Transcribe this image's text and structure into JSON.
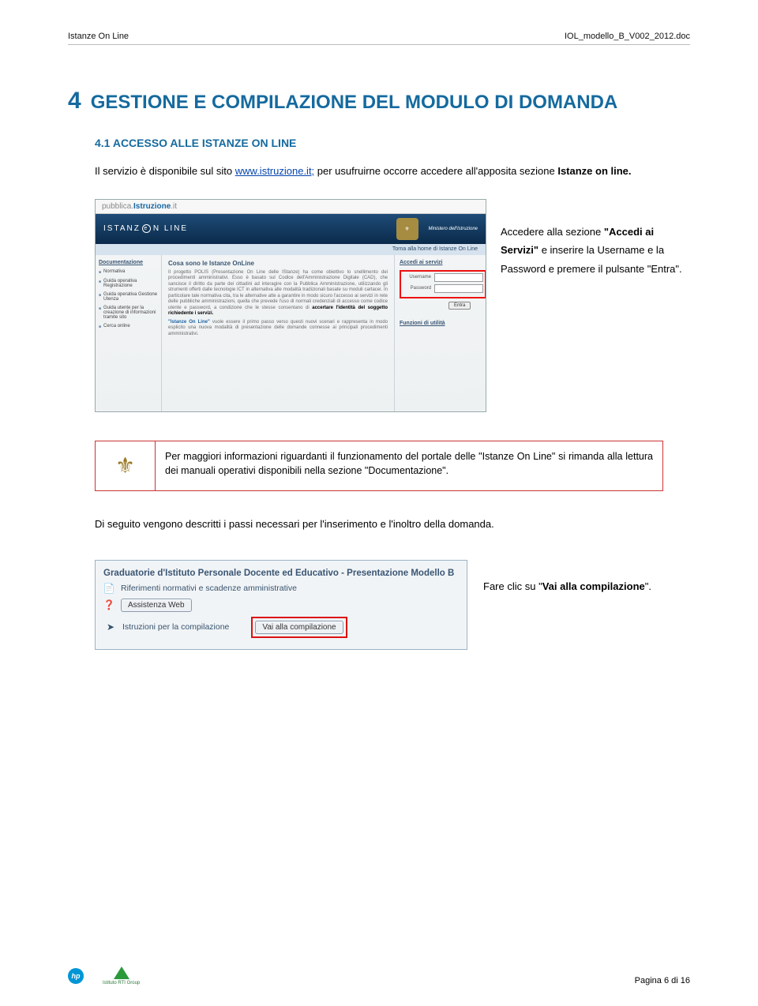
{
  "header": {
    "left": "Istanze On Line",
    "right": "IOL_modello_B_V002_2012.doc"
  },
  "section4": {
    "number": "4",
    "title": "GESTIONE E COMPILAZIONE DEL MODULO DI DOMANDA",
    "subsection_label": "4.1 ACCESSO ALLE ISTANZE ON LINE",
    "para1_a": "Il servizio è disponibile sul sito ",
    "para1_link": "www.istruzione.it;",
    "para1_b": " per usufruirne occorre accedere all'apposita sezione ",
    "para1_bold": "Istanze on line."
  },
  "screenshot": {
    "site_prefix": "pubblica.",
    "site_accent": "Istruzione",
    "site_suffix": ".it",
    "banner_brand_a": "ISTANZ",
    "banner_brand_b": "N LINE",
    "crest_caption": "Ministero dell'Istruzione",
    "subbar": "Torna alla home di Istanze On Line",
    "side_heading": "Documentazione",
    "side_items": [
      "Normativa",
      "Guida operativa Registrazione",
      "Guida operativa Gestione Utenza",
      "Guida utente per la creazione di informazioni tramite sito",
      "Cerca online"
    ],
    "main_heading": "Cosa sono le Istanze OnLine",
    "main_p1": "Il progetto POLIS (Presentazione On Line delle IStanze) ha come obiettivo lo snellimento dei procedimenti amministrativi. Esso è basato sul Codice dell'Amministrazione Digitale (CAD), che sancisce il diritto da parte dei cittadini ad interagire con la Pubblica Amministrazione, utilizzando gli strumenti offerti dalle tecnologie ICT in alternativa alle modalità tradizionali basate su moduli cartacei. In particolare tale normativa cita, tra le alternative atte a garantire in modo sicuro l'accesso ai servizi in rete delle pubbliche amministrazioni, quella che prevede l'uso di normali credenziali di accesso come codice utente e password, a condizione che le stesse consentano di",
    "main_bold": " accertare l'identità del soggetto richiedente i servizi.",
    "main_p2a": "\"Istanze On Line\"",
    "main_p2b": " vuole essere il primo passo verso questi nuovi scenari e rappresenta in modo esplicito una nuova modalità di presentazione delle domande connesse ai principali procedimenti amministrativi.",
    "right_heading": "Accedi ai servizi",
    "login_user_label": "Username",
    "login_pass_label": "Password",
    "entra_btn": "Entra",
    "util_heading": "Funzioni di utilità"
  },
  "side_note": {
    "line1_a": "Accedere alla sezione",
    "line1_b": "\"Accedi ai Servizi\"",
    "line2": " e inserire la Username e la Password e premere il pulsante \"Entra\"."
  },
  "info_box": {
    "text": "Per maggiori informazioni riguardanti il funzionamento del portale delle \"Istanze On Line\" si rimanda alla lettura dei manuali operativi disponibili nella sezione \"Documentazione\"."
  },
  "mid_para": "Di seguito vengono descritti i passi necessari per l'inserimento e l'inoltro della domanda.",
  "ui_panel": {
    "title": "Graduatorie d'Istituto Personale Docente ed Educativo - Presentazione Modello B",
    "row1": "Riferimenti normativi e scadenze amministrative",
    "row2_btn": "Assistenza Web",
    "row3": "Istruzioni per la compilazione",
    "main_btn": "Vai alla compilazione"
  },
  "side_note_2": {
    "a": "Fare clic su \"",
    "b": "Vai alla compilazione",
    "c": "\"."
  },
  "footer": {
    "page": "Pagina 6 di 16",
    "rti": "Istituto RTI Group"
  }
}
